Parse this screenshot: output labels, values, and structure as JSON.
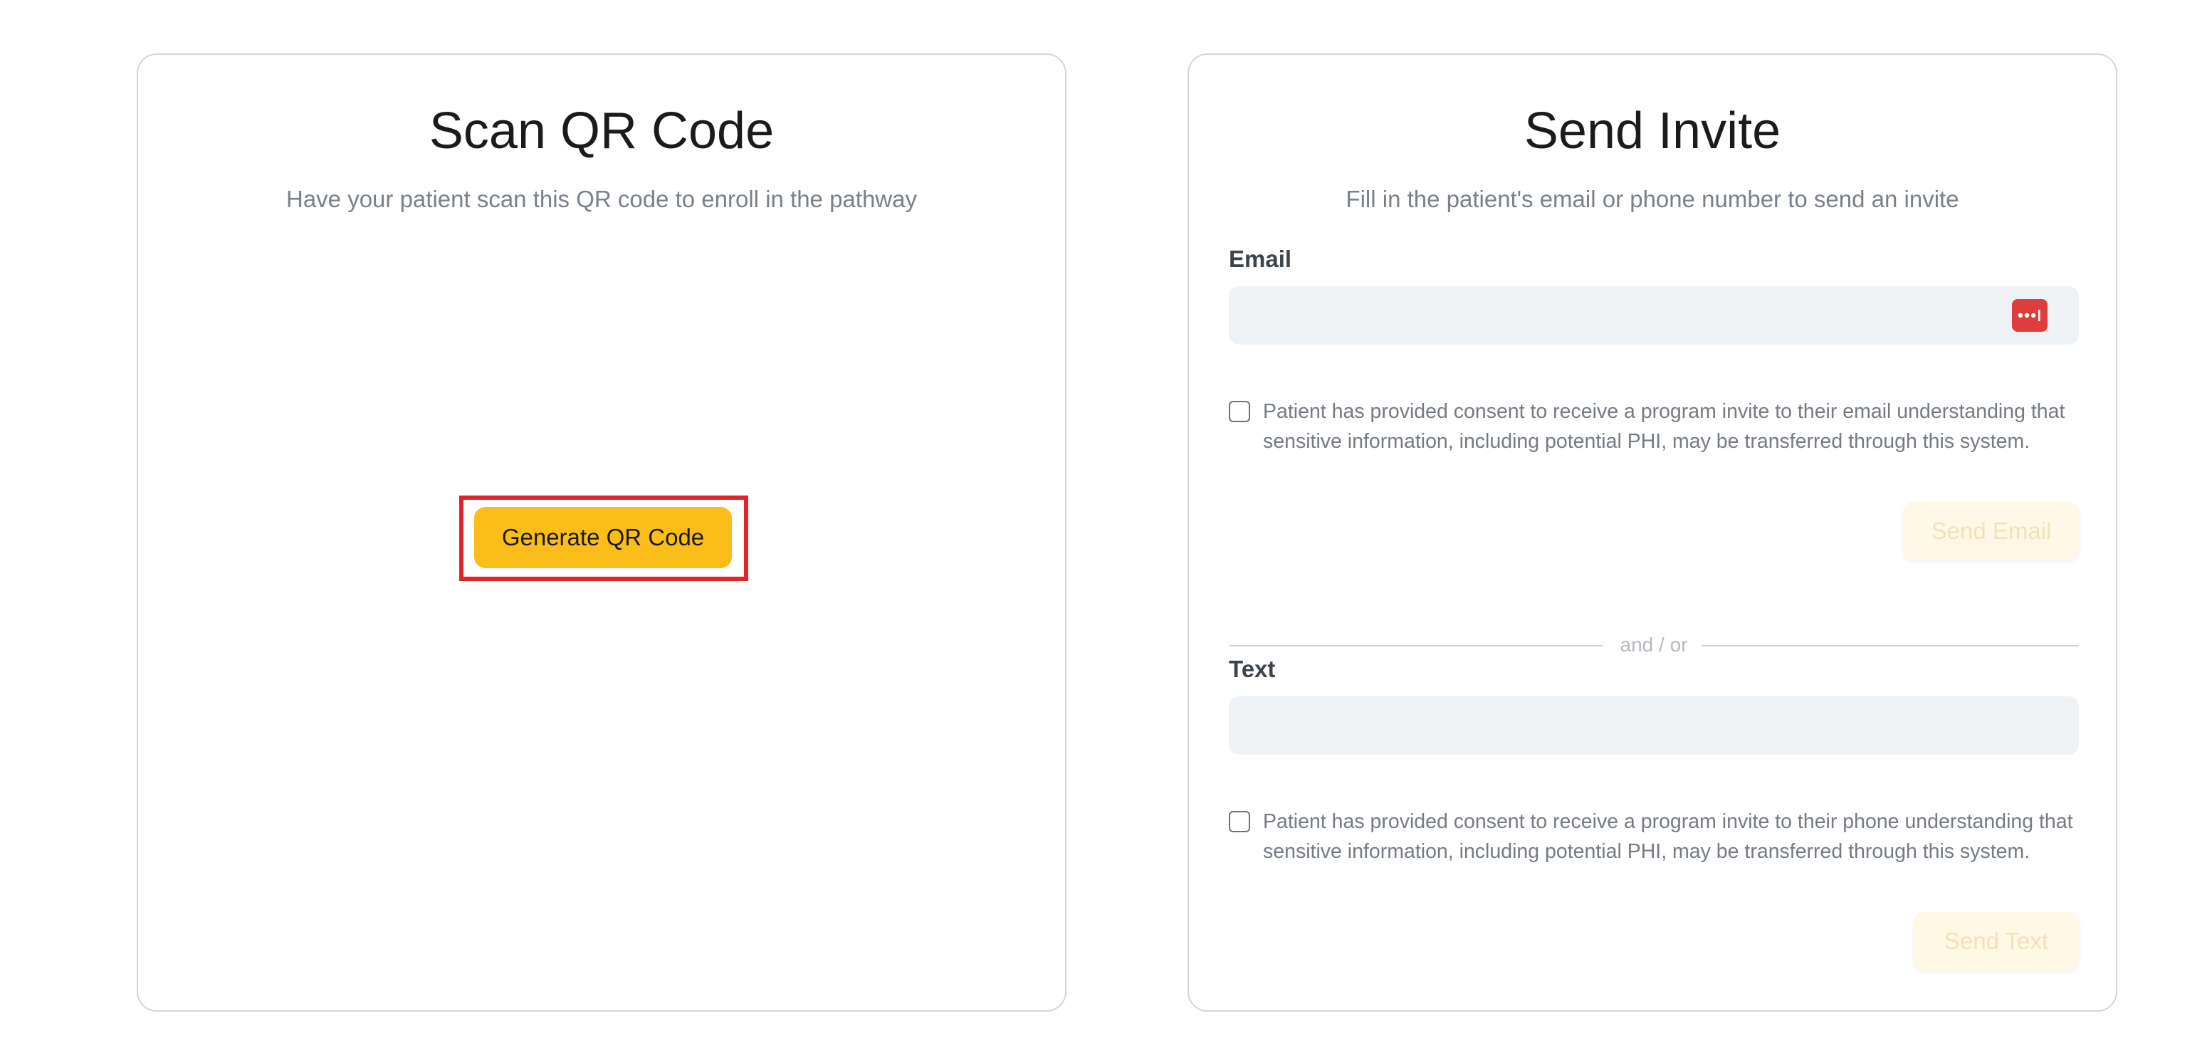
{
  "qr_card": {
    "title": "Scan QR Code",
    "subtitle": "Have your patient scan this QR code to enroll in the pathway",
    "generate_button": "Generate QR Code"
  },
  "invite_card": {
    "title": "Send Invite",
    "subtitle": "Fill in the patient's email or phone number to send an invite",
    "email": {
      "label": "Email",
      "value": "",
      "placeholder": "",
      "consent": "Patient has provided consent to receive a program invite to their email understanding that sensitive information, including potential PHI, may be transferred through this system.",
      "consent_checked": false,
      "send_button": "Send Email",
      "password_manager_icon": "password-manager-icon"
    },
    "divider": "and / or",
    "text": {
      "label": "Text",
      "value": "",
      "placeholder": "",
      "consent": "Patient has provided consent to receive a program invite to their phone understanding that sensitive information, including potential PHI, may be transferred through this system.",
      "consent_checked": false,
      "send_button": "Send Text"
    }
  },
  "colors": {
    "accent": "#fbbd19",
    "highlight": "#e0242b",
    "disabled_button_bg": "#fff8e6",
    "disabled_button_text": "#f3e2b8",
    "input_bg": "#eff2f5",
    "password_icon": "#df3d3d"
  }
}
